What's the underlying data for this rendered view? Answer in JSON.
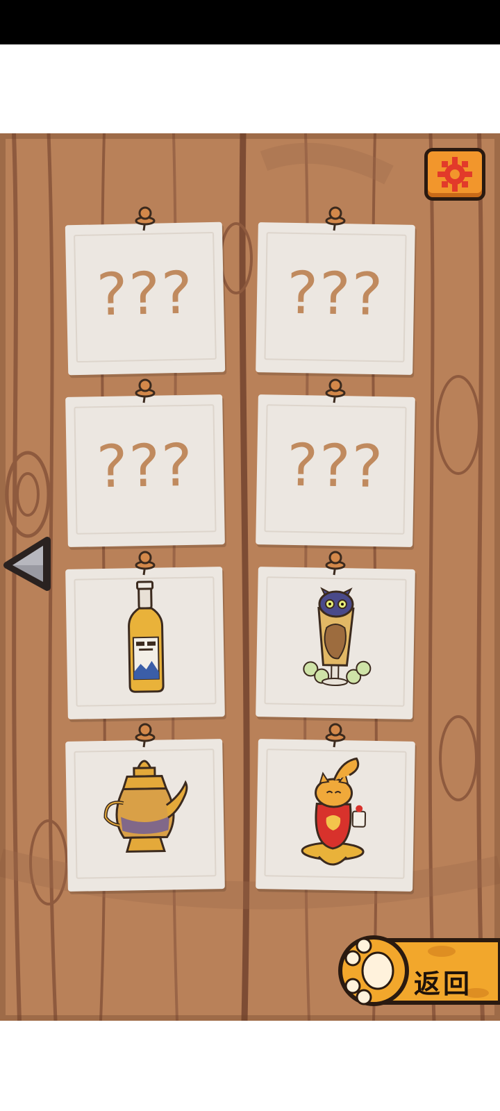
{
  "collection": {
    "cards": [
      {
        "state": "locked",
        "label": "???"
      },
      {
        "state": "locked",
        "label": "???"
      },
      {
        "state": "locked",
        "label": "???"
      },
      {
        "state": "locked",
        "label": "???"
      },
      {
        "state": "unlocked",
        "icon": "liquor-bottle-icon"
      },
      {
        "state": "unlocked",
        "icon": "cat-glass-cup-icon"
      },
      {
        "state": "unlocked",
        "icon": "golden-teapot-icon"
      },
      {
        "state": "unlocked",
        "icon": "cat-figurine-icon"
      }
    ]
  },
  "nav": {
    "prev_icon": "triangle-left-icon",
    "settings_icon": "gear-icon",
    "back_label": "返回"
  },
  "colors": {
    "wood": "#b98159",
    "note": "#ece7e1",
    "question": "#c08a5e",
    "accent_orange": "#f2962c"
  }
}
